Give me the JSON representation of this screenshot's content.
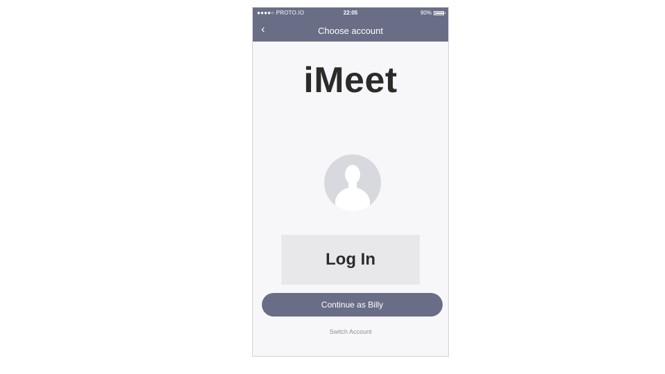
{
  "status_bar": {
    "carrier": "●●●●○ PROTO.IO",
    "time": "22:05",
    "battery": "90%"
  },
  "nav": {
    "back_icon": "chevron-left-icon",
    "back_glyph": "‹",
    "title": "Choose account"
  },
  "app": {
    "logo_text": "iMeet"
  },
  "avatar": {
    "icon": "user-silhouette-icon"
  },
  "login": {
    "label": "Log In"
  },
  "continue": {
    "label": "Continue as Billy"
  },
  "switch": {
    "label": "Switch Account"
  },
  "colors": {
    "header_bg": "#6a6d86",
    "screen_bg": "#f7f7f9",
    "avatar_bg": "#d8d9de",
    "login_bg": "#e8e8ea",
    "text_dark": "#2b2b2b",
    "link_gray": "#8e8f99"
  }
}
